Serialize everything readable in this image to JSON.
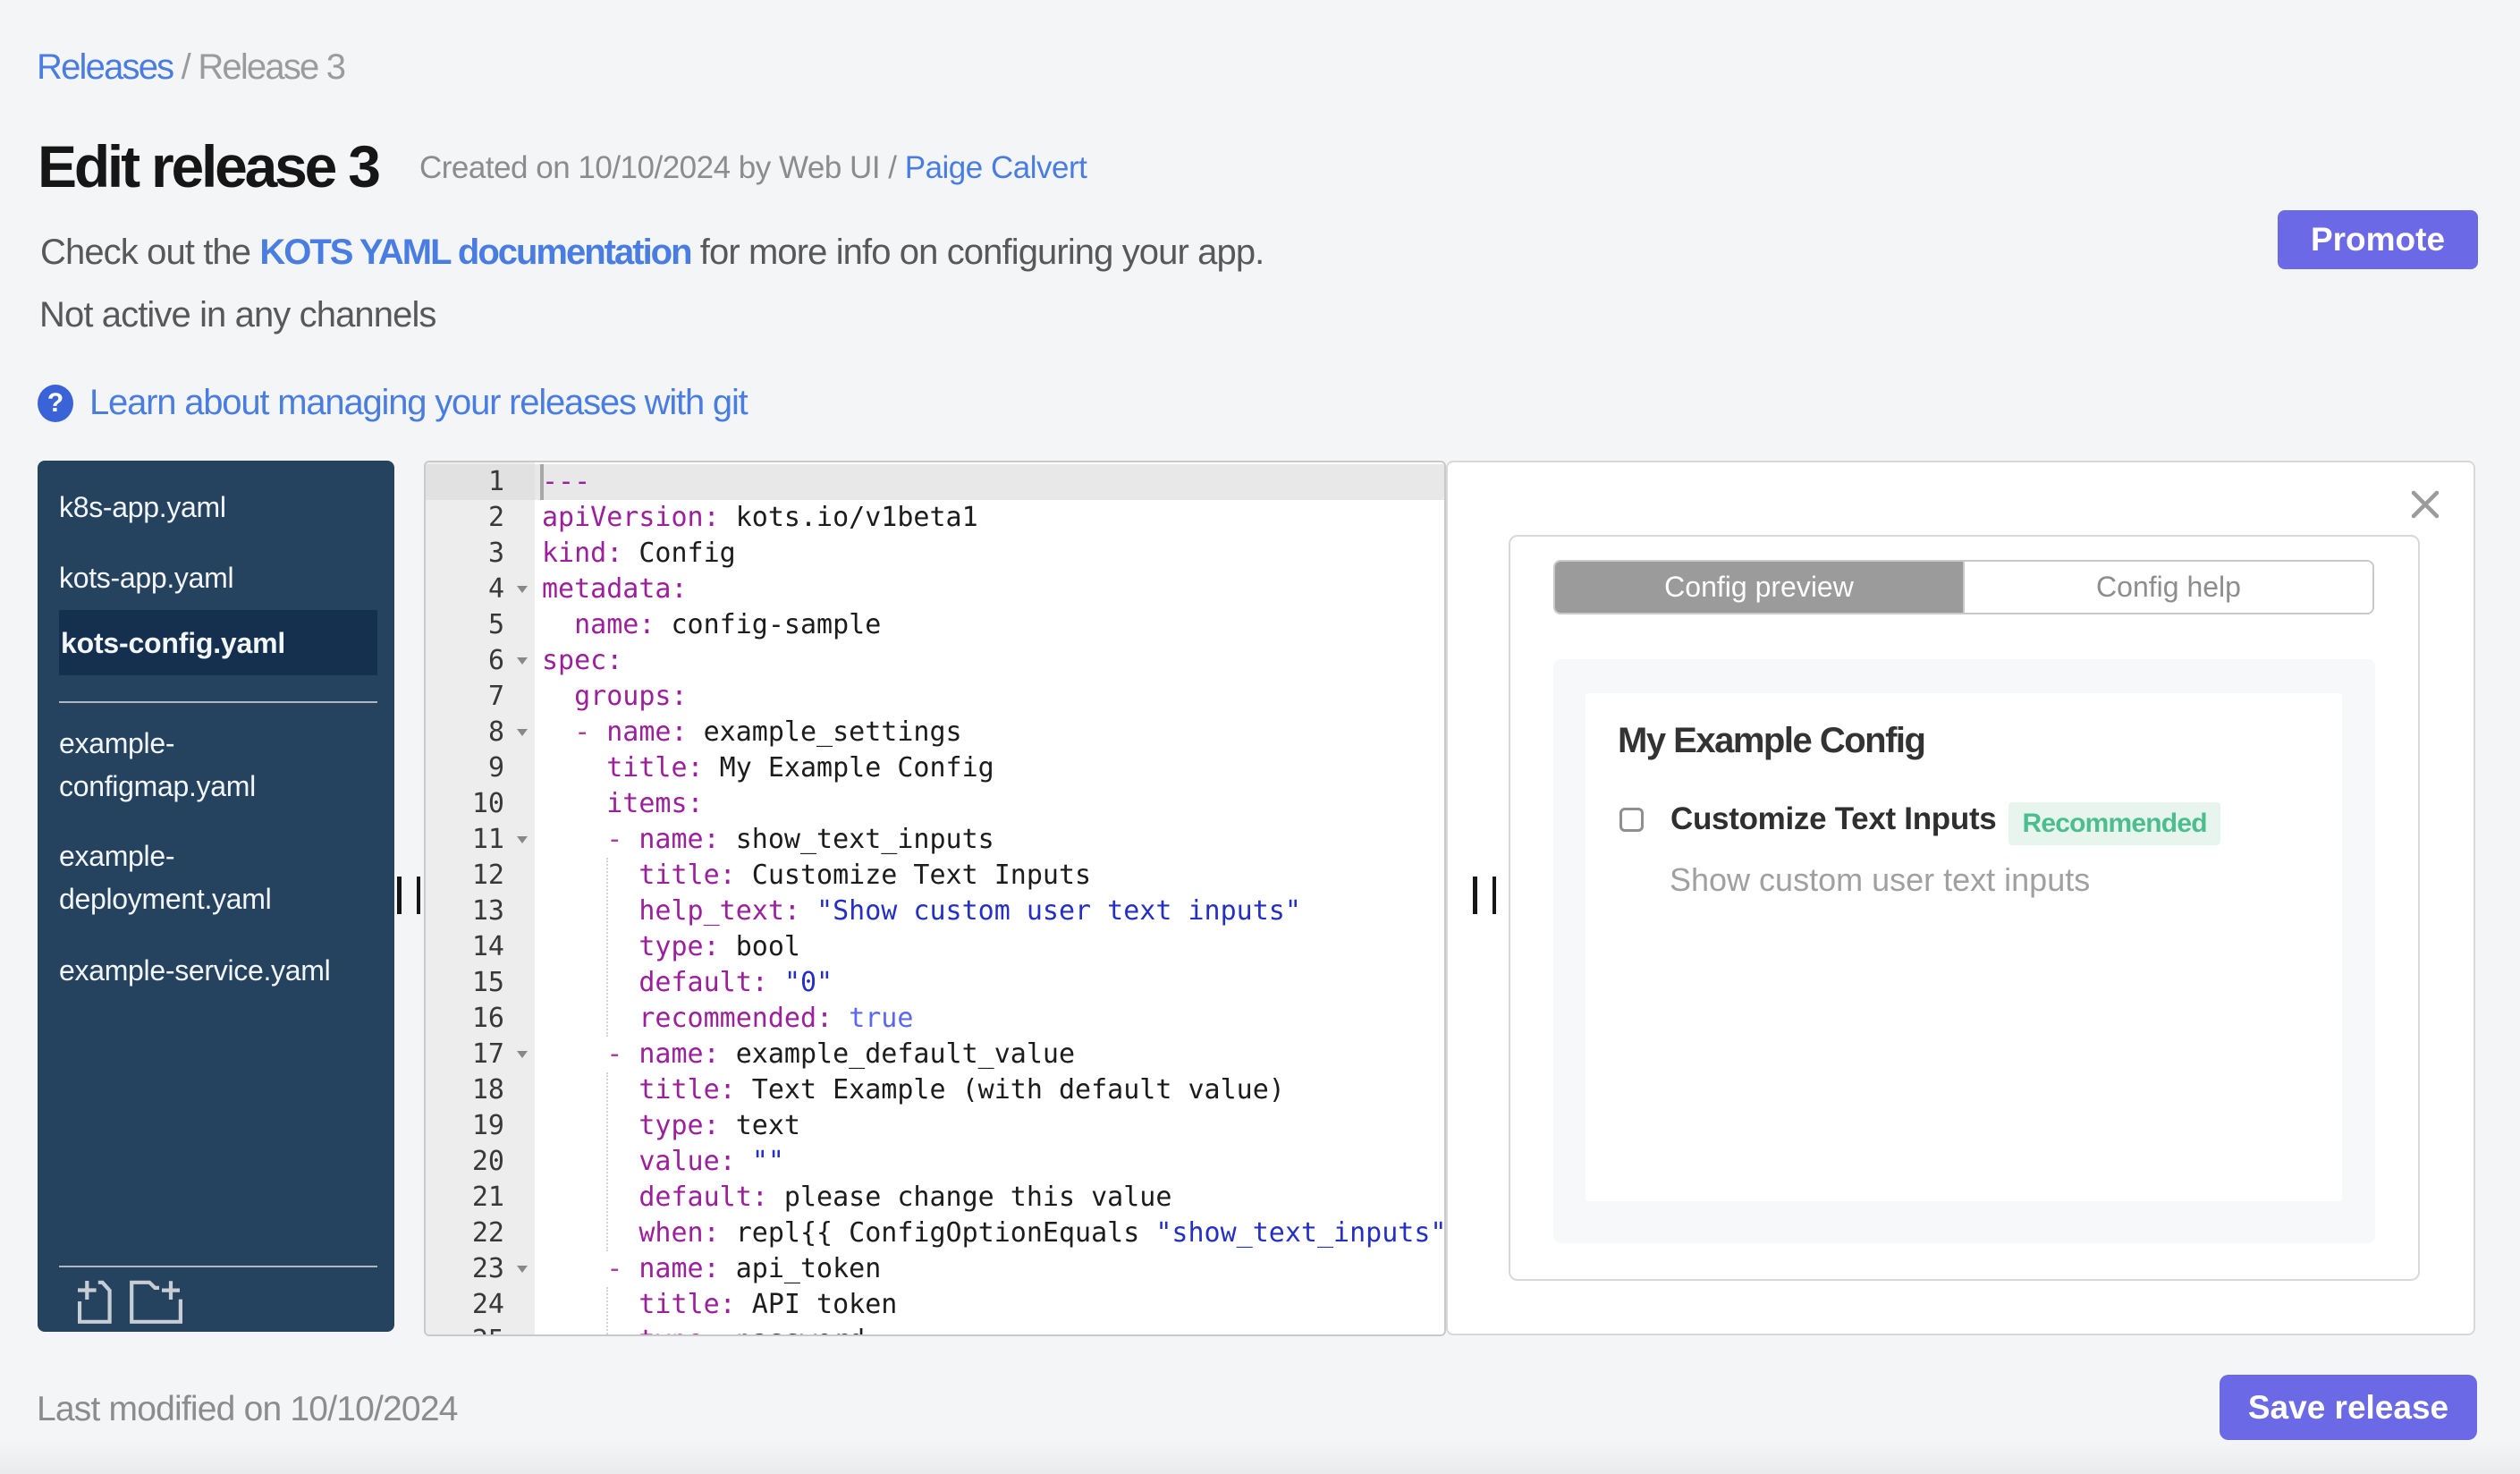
{
  "breadcrumb": {
    "link": "Releases",
    "separator": " / ",
    "current": "Release 3"
  },
  "header": {
    "title": "Edit release 3",
    "created_prefix": "Created on 10/10/2024 by Web UI / ",
    "created_link": "Paige Calvert"
  },
  "info": {
    "pre": "Check out the ",
    "link": "KOTS YAML documentation",
    "post": " for more info on configuring your app.",
    "status": "Not active in any channels"
  },
  "git_help": {
    "icon": "?",
    "label": "Learn about managing your releases with git"
  },
  "toolbar": {
    "promote_label": "Promote"
  },
  "sidebar": {
    "files": [
      {
        "label": "k8s-app.yaml",
        "selected": false,
        "group": 1
      },
      {
        "label": "kots-app.yaml",
        "selected": false,
        "group": 1
      },
      {
        "label": "kots-config.yaml",
        "selected": true,
        "group": 1
      },
      {
        "label": "example-configmap.yaml",
        "selected": false,
        "group": 2
      },
      {
        "label": "example-deployment.yaml",
        "selected": false,
        "group": 2
      },
      {
        "label": "example-service.yaml",
        "selected": false,
        "group": 2
      }
    ],
    "icons": [
      "new-file-icon",
      "new-folder-icon"
    ]
  },
  "editor": {
    "active_line": 1,
    "fold_lines": [
      4,
      6,
      8,
      11,
      17,
      23
    ],
    "lines": [
      [
        [
          "k",
          "---"
        ]
      ],
      [
        [
          "k",
          "apiVersion:"
        ],
        [
          "p",
          " kots.io/v1beta1"
        ]
      ],
      [
        [
          "k",
          "kind:"
        ],
        [
          "p",
          " Config"
        ]
      ],
      [
        [
          "k",
          "metadata:"
        ]
      ],
      [
        [
          "p",
          "  "
        ],
        [
          "k",
          "name:"
        ],
        [
          "p",
          " config-sample"
        ]
      ],
      [
        [
          "k",
          "spec:"
        ]
      ],
      [
        [
          "p",
          "  "
        ],
        [
          "k",
          "groups:"
        ]
      ],
      [
        [
          "p",
          "  "
        ],
        [
          "d",
          "-"
        ],
        [
          "p",
          " "
        ],
        [
          "k",
          "name:"
        ],
        [
          "p",
          " example_settings"
        ]
      ],
      [
        [
          "p",
          "    "
        ],
        [
          "k",
          "title:"
        ],
        [
          "p",
          " My Example Config"
        ]
      ],
      [
        [
          "p",
          "    "
        ],
        [
          "k",
          "items:"
        ]
      ],
      [
        [
          "p",
          "    "
        ],
        [
          "d",
          "-"
        ],
        [
          "p",
          " "
        ],
        [
          "k",
          "name:"
        ],
        [
          "p",
          " show_text_inputs"
        ]
      ],
      [
        [
          "p",
          "      "
        ],
        [
          "k",
          "title:"
        ],
        [
          "p",
          " Customize Text Inputs"
        ]
      ],
      [
        [
          "p",
          "      "
        ],
        [
          "k",
          "help_text:"
        ],
        [
          "p",
          " "
        ],
        [
          "s",
          "\"Show custom user text inputs\""
        ]
      ],
      [
        [
          "p",
          "      "
        ],
        [
          "k",
          "type:"
        ],
        [
          "p",
          " bool"
        ]
      ],
      [
        [
          "p",
          "      "
        ],
        [
          "k",
          "default:"
        ],
        [
          "p",
          " "
        ],
        [
          "s",
          "\"0\""
        ]
      ],
      [
        [
          "p",
          "      "
        ],
        [
          "k",
          "recommended:"
        ],
        [
          "p",
          " "
        ],
        [
          "b",
          "true"
        ]
      ],
      [
        [
          "p",
          "    "
        ],
        [
          "d",
          "-"
        ],
        [
          "p",
          " "
        ],
        [
          "k",
          "name:"
        ],
        [
          "p",
          " example_default_value"
        ]
      ],
      [
        [
          "p",
          "      "
        ],
        [
          "k",
          "title:"
        ],
        [
          "p",
          " Text Example (with default value)"
        ]
      ],
      [
        [
          "p",
          "      "
        ],
        [
          "k",
          "type:"
        ],
        [
          "p",
          " text"
        ]
      ],
      [
        [
          "p",
          "      "
        ],
        [
          "k",
          "value:"
        ],
        [
          "p",
          " "
        ],
        [
          "s",
          "\"\""
        ]
      ],
      [
        [
          "p",
          "      "
        ],
        [
          "k",
          "default:"
        ],
        [
          "p",
          " please change this value"
        ]
      ],
      [
        [
          "p",
          "      "
        ],
        [
          "k",
          "when:"
        ],
        [
          "p",
          " repl{{ ConfigOptionEquals "
        ],
        [
          "s",
          "\"show_text_inputs\""
        ]
      ],
      [
        [
          "p",
          "    "
        ],
        [
          "d",
          "-"
        ],
        [
          "p",
          " "
        ],
        [
          "k",
          "name:"
        ],
        [
          "p",
          " api_token"
        ]
      ],
      [
        [
          "p",
          "      "
        ],
        [
          "k",
          "title:"
        ],
        [
          "p",
          " API token"
        ]
      ],
      [
        [
          "p",
          "      "
        ],
        [
          "k",
          "type:"
        ],
        [
          "p",
          " password"
        ]
      ]
    ]
  },
  "preview": {
    "tabs": [
      {
        "label": "Config preview",
        "active": true
      },
      {
        "label": "Config help",
        "active": false
      }
    ],
    "heading": "My Example Config",
    "item": {
      "label": "Customize Text Inputs",
      "badge": "Recommended",
      "help": "Show custom user text inputs",
      "checked": false
    }
  },
  "footer": {
    "last_modified": "Last modified on 10/10/2024",
    "save_label": "Save release"
  },
  "colors": {
    "accent": "#6c69e6",
    "link": "#4a7de2",
    "page_bg": "#f4f5f7",
    "sidebar_bg": "#25425f",
    "sidebar_selected_bg": "#15304e",
    "badge_green": "#4cbe8d",
    "badge_bg": "#e7f5ee",
    "tab_active_bg": "#9b9b9b",
    "editor_key": "#9c209c",
    "editor_plain": "#1c1c1c",
    "editor_string": "#2430c4",
    "editor_bool": "#5a68ee",
    "editor_dash": "#b03aa0"
  },
  "icons": [
    "question-icon",
    "close-icon",
    "new-file-icon",
    "new-folder-icon",
    "fold-arrow-icon",
    "drag-handle"
  ]
}
